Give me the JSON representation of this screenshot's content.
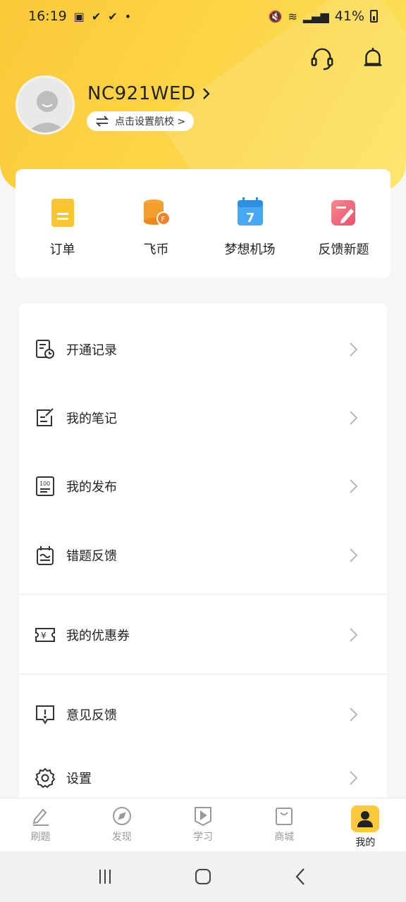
{
  "status": {
    "time": "16:19",
    "battery": "41%"
  },
  "profile": {
    "name": "NC921WED",
    "school_pill": "点击设置航校 >"
  },
  "quick_actions": [
    {
      "label": "订单",
      "icon": "order-icon"
    },
    {
      "label": "飞币",
      "icon": "coin-icon"
    },
    {
      "label": "梦想机场",
      "icon": "calendar-icon",
      "number": "7"
    },
    {
      "label": "反馈新题",
      "icon": "edit-icon"
    }
  ],
  "menu": [
    {
      "label": "开通记录",
      "icon": "record-icon"
    },
    {
      "label": "我的笔记",
      "icon": "note-icon"
    },
    {
      "label": "我的发布",
      "icon": "publish-icon"
    },
    {
      "label": "错题反馈",
      "icon": "error-feedback-icon"
    },
    {
      "label": "我的优惠券",
      "icon": "coupon-icon"
    },
    {
      "label": "意见反馈",
      "icon": "feedback-icon"
    },
    {
      "label": "设置",
      "icon": "settings-icon"
    }
  ],
  "tabs": [
    {
      "label": "刷题",
      "icon": "pencil-icon"
    },
    {
      "label": "发现",
      "icon": "compass-icon"
    },
    {
      "label": "学习",
      "icon": "play-icon"
    },
    {
      "label": "商城",
      "icon": "bag-icon"
    },
    {
      "label": "我的",
      "icon": "person-icon",
      "active": true
    }
  ],
  "colors": {
    "accent": "#fbc93a",
    "card": "#ffffff",
    "bg": "#f6f6f6"
  }
}
